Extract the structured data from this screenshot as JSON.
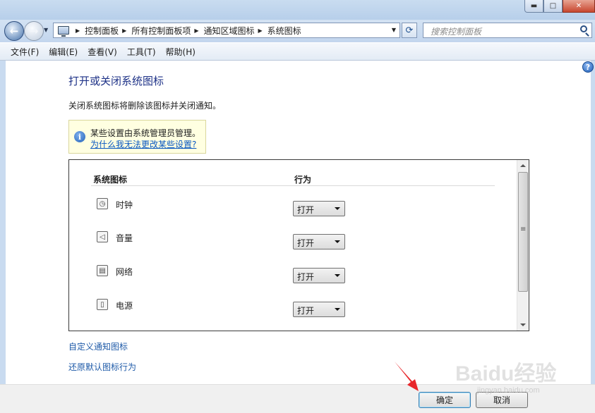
{
  "window": {
    "minimize_glyph": "▬",
    "maximize_glyph": "□",
    "close_glyph": "✕"
  },
  "nav": {
    "back_icon": "back-arrow-icon",
    "forward_icon": "forward-arrow-icon",
    "breadcrumbs": [
      "控制面板",
      "所有控制面板项",
      "通知区域图标",
      "系统图标"
    ],
    "search_placeholder": "搜索控制面板"
  },
  "menu": {
    "items": [
      "文件(F)",
      "编辑(E)",
      "查看(V)",
      "工具(T)",
      "帮助(H)"
    ]
  },
  "main": {
    "title": "打开或关闭系统图标",
    "description": "关闭系统图标将删除该图标并关闭通知。",
    "notice": {
      "text": "某些设置由系统管理员管理。",
      "link": "为什么我无法更改某些设置?"
    },
    "table": {
      "headers": [
        "系统图标",
        "行为"
      ],
      "rows": [
        {
          "icon": "clock-icon",
          "label": "时钟",
          "behavior": "打开"
        },
        {
          "icon": "volume-icon",
          "label": "音量",
          "behavior": "打开"
        },
        {
          "icon": "network-icon",
          "label": "网络",
          "behavior": "打开"
        },
        {
          "icon": "power-icon",
          "label": "电源",
          "behavior": "打开"
        }
      ]
    },
    "links": {
      "customize": "自定义通知图标",
      "restore": "还原默认图标行为"
    }
  },
  "buttons": {
    "ok": "确定",
    "cancel": "取消"
  },
  "watermark": {
    "text": "Baidu经验",
    "sub": "jingyan.baidu.com"
  },
  "colors": {
    "title_text": "#1e3287",
    "link_text": "#1e5aa8",
    "notice_bg": "#ffffe1",
    "annotation_arrow": "#e8262a"
  }
}
